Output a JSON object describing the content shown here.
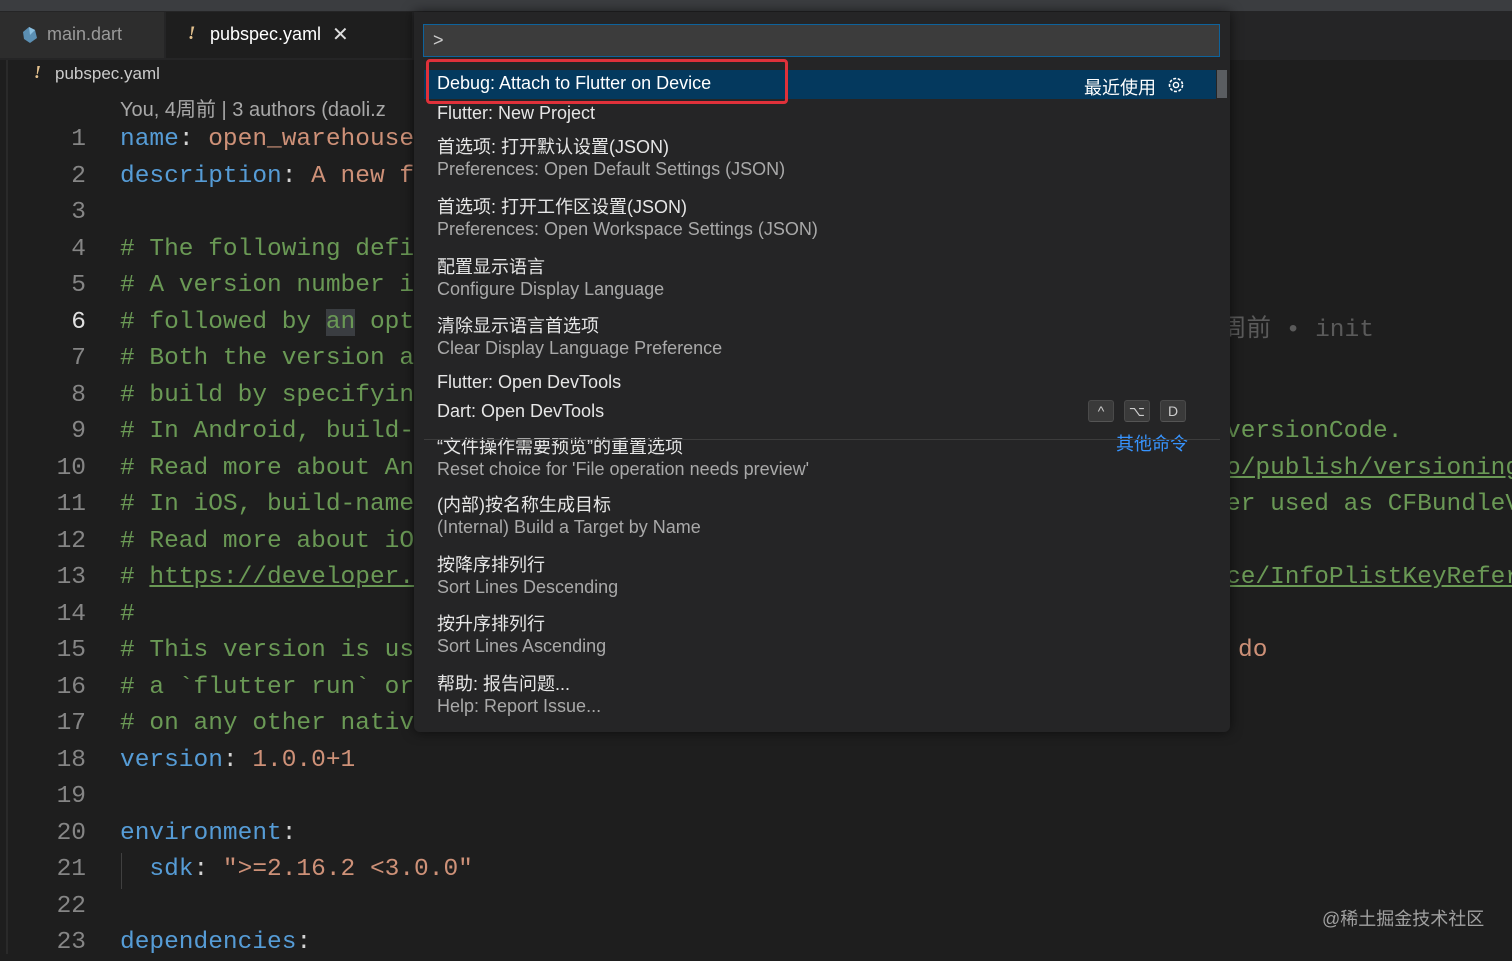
{
  "tabs": [
    {
      "label": "main.dart",
      "icon": "dart-icon",
      "active": false
    },
    {
      "label": "pubspec.yaml",
      "icon": "warning-bang-icon",
      "active": true,
      "close": "✕"
    }
  ],
  "breadcrumb": {
    "bang": "!",
    "file": "pubspec.yaml"
  },
  "blame": "You, 4周前 | 3 authors (daoli.z",
  "editor": {
    "lines": [
      {
        "n": "1",
        "parts": [
          [
            "key",
            "name"
          ],
          [
            "punc",
            ": "
          ],
          [
            "str",
            "open_warehouse"
          ]
        ]
      },
      {
        "n": "2",
        "parts": [
          [
            "key",
            "description"
          ],
          [
            "punc",
            ": "
          ],
          [
            "str",
            "A new f"
          ]
        ]
      },
      {
        "n": "3",
        "parts": []
      },
      {
        "n": "4",
        "parts": [
          [
            "cmt",
            "# The following defi"
          ]
        ]
      },
      {
        "n": "5",
        "parts": [
          [
            "cmt",
            "# A version number i"
          ]
        ]
      },
      {
        "n": "6",
        "parts": [
          [
            "cmt",
            "# followed by "
          ],
          [
            "hlcmt",
            "an"
          ],
          [
            "cmt",
            " opt"
          ]
        ],
        "active": true
      },
      {
        "n": "7",
        "parts": [
          [
            "cmt",
            "# Both the version a"
          ]
        ]
      },
      {
        "n": "8",
        "parts": [
          [
            "cmt",
            "# build by specifyin"
          ]
        ]
      },
      {
        "n": "9",
        "parts": [
          [
            "cmt",
            "# In Android, build-"
          ]
        ]
      },
      {
        "n": "10",
        "parts": [
          [
            "cmt",
            "# Read more about An"
          ]
        ]
      },
      {
        "n": "11",
        "parts": [
          [
            "cmt",
            "# In iOS, build-name"
          ]
        ]
      },
      {
        "n": "12",
        "parts": [
          [
            "cmt",
            "# Read more about iO"
          ]
        ]
      },
      {
        "n": "13",
        "parts": [
          [
            "cmt",
            "# "
          ],
          [
            "url",
            "https://developer."
          ]
        ]
      },
      {
        "n": "14",
        "parts": [
          [
            "cmt",
            "#"
          ]
        ]
      },
      {
        "n": "15",
        "parts": [
          [
            "cmt",
            "# This version is us"
          ]
        ]
      },
      {
        "n": "16",
        "parts": [
          [
            "cmt",
            "# a `flutter run` or"
          ]
        ]
      },
      {
        "n": "17",
        "parts": [
          [
            "cmt",
            "# on any other nativ"
          ]
        ]
      },
      {
        "n": "18",
        "parts": [
          [
            "key",
            "version"
          ],
          [
            "punc",
            ": "
          ],
          [
            "str",
            "1.0.0+1"
          ]
        ]
      },
      {
        "n": "19",
        "parts": []
      },
      {
        "n": "20",
        "parts": [
          [
            "key",
            "environment"
          ],
          [
            "punc",
            ":"
          ]
        ]
      },
      {
        "n": "21",
        "parts": [
          [
            "punc",
            "  "
          ],
          [
            "key",
            "sdk"
          ],
          [
            "punc",
            ": "
          ],
          [
            "str",
            "\">=2.16.2 <3.0.0\""
          ]
        ]
      },
      {
        "n": "22",
        "parts": []
      },
      {
        "n": "23",
        "parts": [
          [
            "key",
            "dependencies"
          ],
          [
            "punc",
            ":"
          ]
        ]
      }
    ],
    "right_fragments": {
      "6": "周前 • init",
      "9": "versionCode.",
      "10": "o/publish/versioning",
      "11": "er used as CFBundleV",
      "13": "ce/InfoPlistKeyRefer",
      "15": "do"
    }
  },
  "palette": {
    "input_value": ">",
    "items": [
      {
        "primary": "Debug: Attach to Flutter on Device",
        "badge": "最近使用",
        "selected": true
      },
      {
        "primary": "Flutter: New Project"
      },
      {
        "primary": "首选项: 打开默认设置(JSON)",
        "secondary": "Preferences: Open Default Settings (JSON)"
      },
      {
        "primary": "首选项: 打开工作区设置(JSON)",
        "secondary": "Preferences: Open Workspace Settings (JSON)"
      },
      {
        "primary": "配置显示语言",
        "secondary": "Configure Display Language"
      },
      {
        "primary": "清除显示语言首选项",
        "secondary": "Clear Display Language Preference"
      },
      {
        "primary": "Flutter: Open DevTools"
      },
      {
        "primary": "Dart: Open DevTools",
        "keys": [
          "^",
          "⌥",
          "D"
        ]
      },
      {
        "primary": "“文件操作需要预览”的重置选项",
        "secondary": "Reset choice for 'File operation needs preview'",
        "badge": "其他命令"
      },
      {
        "primary": "(内部)按名称生成目标",
        "secondary": "(Internal) Build a Target by Name"
      },
      {
        "primary": "按降序排列行",
        "secondary": "Sort Lines Descending"
      },
      {
        "primary": "按升序排列行",
        "secondary": "Sort Lines Ascending"
      },
      {
        "primary": "帮助: 报告问题...",
        "secondary": "Help: Report Issue..."
      }
    ]
  },
  "watermark": "@稀土掘金技术社区",
  "colors": {
    "accent": "#04395e",
    "highlight_border": "#e0313a",
    "link": "#3794ff"
  }
}
